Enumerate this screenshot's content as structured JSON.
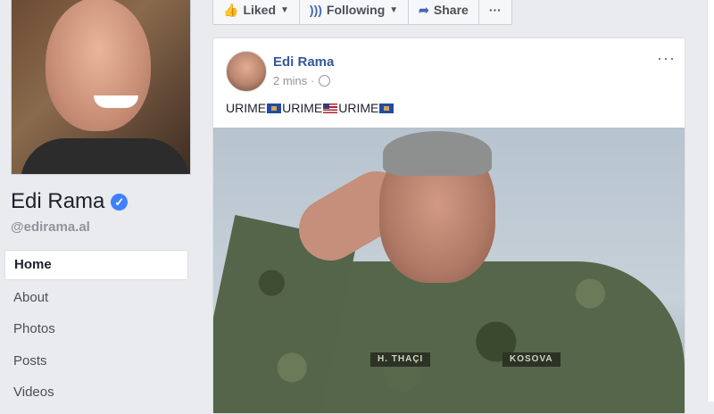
{
  "profile": {
    "name": "Edi Rama",
    "handle": "@edirama.al"
  },
  "nav": {
    "items": [
      "Home",
      "About",
      "Photos",
      "Posts",
      "Videos"
    ],
    "active": "Home"
  },
  "actions": {
    "liked": "Liked",
    "following": "Following",
    "share": "Share",
    "more": "···"
  },
  "post": {
    "author": "Edi Rama",
    "time": "2 mins",
    "menu": "···",
    "text_segments": [
      "URIME",
      "URIME",
      "URIME"
    ],
    "photo_tags": [
      "H. THAÇI",
      "KOSOVA"
    ]
  },
  "colors": {
    "link": "#365899",
    "accent": "#4267b2",
    "verified": "#4080ff",
    "background": "#e9ebee"
  },
  "icons": {
    "verified": "verified-badge-icon",
    "liked": "thumbs-up-icon",
    "following": "rss-feed-icon",
    "share": "share-arrow-icon",
    "globe": "globe-icon"
  }
}
